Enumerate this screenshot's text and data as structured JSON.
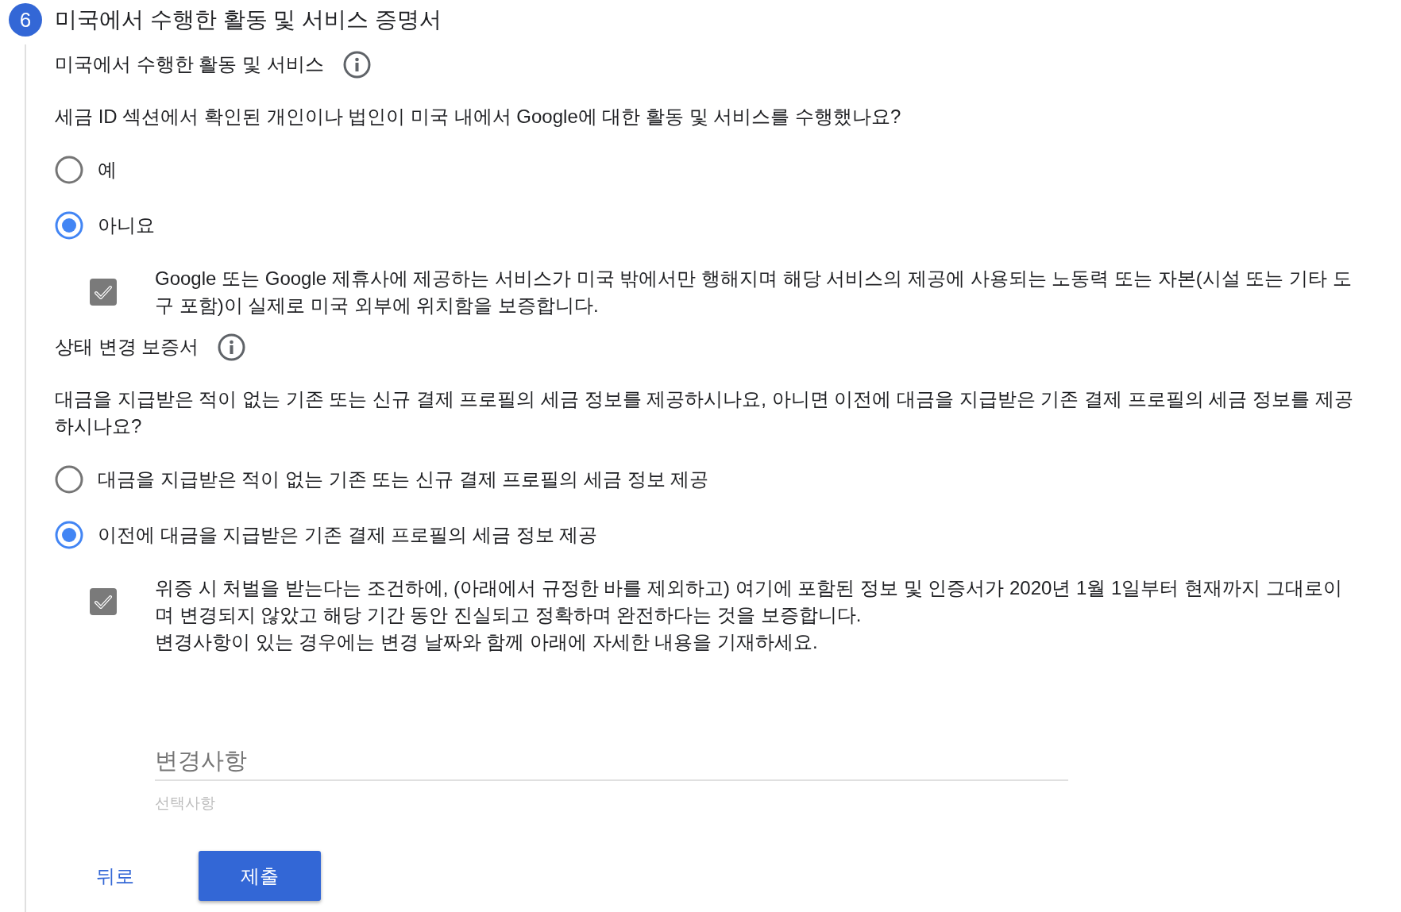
{
  "step": {
    "number": "6",
    "title": "미국에서 수행한 활동 및 서비스 증명서"
  },
  "sections": [
    {
      "heading": "미국에서 수행한 활동 및 서비스",
      "question": "세금 ID 섹션에서 확인된 개인이나 법인이 미국 내에서 Google에 대한 활동 및 서비스를 수행했나요?",
      "options": [
        {
          "label": "예",
          "selected": false
        },
        {
          "label": "아니요",
          "selected": true
        }
      ],
      "attestation": {
        "checked": true,
        "paragraphs": [
          "Google 또는 Google 제휴사에 제공하는 서비스가 미국 밖에서만 행해지며 해당 서비스의 제공에 사용되는 노동력 또는 자본(시설 또는 기타 도구 포함)이 실제로 미국 외부에 위치함을 보증합니다."
        ]
      }
    },
    {
      "heading": "상태 변경 보증서",
      "question": "대금을 지급받은 적이 없는 기존 또는 신규 결제 프로필의 세금 정보를 제공하시나요, 아니면 이전에 대금을 지급받은 기존 결제 프로필의 세금 정보를 제공하시나요?",
      "options": [
        {
          "label": "대금을 지급받은 적이 없는 기존 또는 신규 결제 프로필의 세금 정보 제공",
          "selected": false
        },
        {
          "label": "이전에 대금을 지급받은 기존 결제 프로필의 세금 정보 제공",
          "selected": true
        }
      ],
      "attestation": {
        "checked": true,
        "paragraphs": [
          "위증 시 처벌을 받는다는 조건하에, (아래에서 규정한 바를 제외하고) 여기에 포함된 정보 및 인증서가 2020년 1월 1일부터 현재까지 그대로이며 변경되지 않았고 해당 기간 동안 진실되고 정확하며 완전하다는 것을 보증합니다.",
          "변경사항이 있는 경우에는 변경 날짜와 함께 아래에 자세한 내용을 기재하세요."
        ]
      }
    }
  ],
  "changes_field": {
    "placeholder": "변경사항",
    "helper": "선택사항"
  },
  "buttons": [
    {
      "label": "뒤로",
      "kind": "text"
    },
    {
      "label": "제출",
      "kind": "primary"
    }
  ]
}
